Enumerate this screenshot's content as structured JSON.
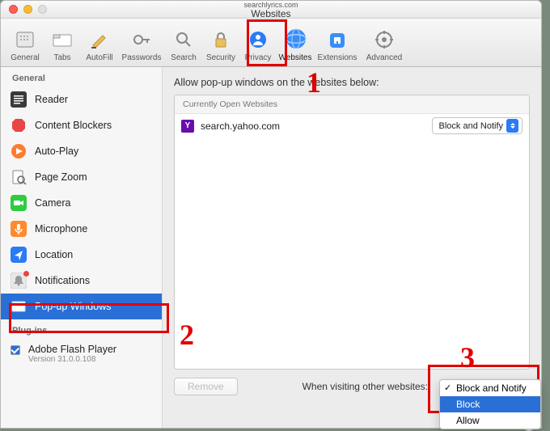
{
  "title": {
    "url": "searchlyrics.com",
    "window": "Websites"
  },
  "toolbar": {
    "items": [
      {
        "label": "General"
      },
      {
        "label": "Tabs"
      },
      {
        "label": "AutoFill"
      },
      {
        "label": "Passwords"
      },
      {
        "label": "Search"
      },
      {
        "label": "Security"
      },
      {
        "label": "Privacy"
      },
      {
        "label": "Websites"
      },
      {
        "label": "Extensions"
      },
      {
        "label": "Advanced"
      }
    ]
  },
  "sidebar": {
    "heads": {
      "general": "General",
      "plugins": "Plug-ins"
    },
    "items": [
      {
        "label": "Reader"
      },
      {
        "label": "Content Blockers"
      },
      {
        "label": "Auto-Play"
      },
      {
        "label": "Page Zoom"
      },
      {
        "label": "Camera"
      },
      {
        "label": "Microphone"
      },
      {
        "label": "Location"
      },
      {
        "label": "Notifications"
      },
      {
        "label": "Pop-up Windows"
      }
    ],
    "plugin": {
      "label": "Adobe Flash Player",
      "version": "Version 31.0.0.108"
    }
  },
  "main": {
    "heading": "Allow pop-up windows on the websites below:",
    "section_head": "Currently Open Websites",
    "rows": [
      {
        "site": "search.yahoo.com",
        "favicon": "Y",
        "policy": "Block and Notify"
      }
    ],
    "remove_label": "Remove",
    "footer_label": "When visiting other websites:",
    "dropdown": [
      {
        "label": "Block and Notify",
        "checked": true
      },
      {
        "label": "Block",
        "selected": true
      },
      {
        "label": "Allow"
      }
    ]
  },
  "annotations": {
    "n1": "1",
    "n2": "2",
    "n3": "3"
  }
}
